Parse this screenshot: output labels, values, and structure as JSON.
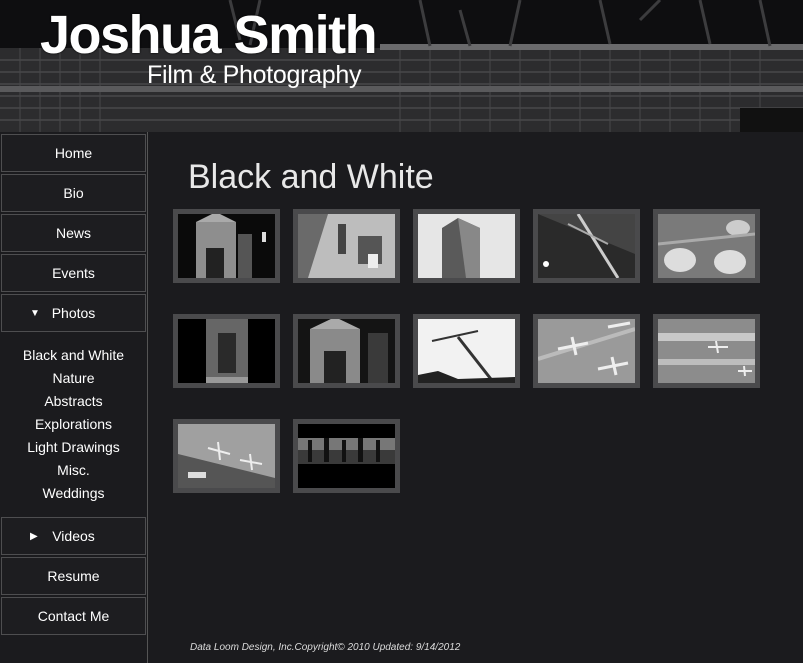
{
  "header": {
    "site_title": "Joshua Smith",
    "site_subtitle": "Film & Photography"
  },
  "sidebar": {
    "items": [
      {
        "label": "Home"
      },
      {
        "label": "Bio"
      },
      {
        "label": "News"
      },
      {
        "label": "Events"
      },
      {
        "label": "Photos",
        "icon": "triangle-down-icon"
      },
      {
        "label": "Videos",
        "icon": "triangle-right-icon"
      },
      {
        "label": "Resume"
      },
      {
        "label": "Contact Me"
      }
    ],
    "photo_subitems": [
      {
        "label": "Black and White"
      },
      {
        "label": "Nature"
      },
      {
        "label": "Abstracts"
      },
      {
        "label": "Explorations"
      },
      {
        "label": "Light Drawings"
      },
      {
        "label": "Misc."
      },
      {
        "label": "Weddings"
      }
    ]
  },
  "main": {
    "page_title": "Black and White",
    "thumbnails": [
      {
        "subject": "cathedral"
      },
      {
        "subject": "aerial-construction"
      },
      {
        "subject": "skyscraper"
      },
      {
        "subject": "tower-crane"
      },
      {
        "subject": "storage-tanks"
      },
      {
        "subject": "church-door"
      },
      {
        "subject": "cathedral"
      },
      {
        "subject": "crane"
      },
      {
        "subject": "airport-planes"
      },
      {
        "subject": "airport-runway"
      },
      {
        "subject": "airport-terminal"
      },
      {
        "subject": "silhouettes"
      }
    ]
  },
  "footer": {
    "text": "Data Loom Design, Inc.Copyright© 2010 Updated: 9/14/2012"
  },
  "colors": {
    "background": "#1b1b1e",
    "border": "#4e4e50",
    "thumb_frame": "#4a4a4c",
    "text": "#ffffff"
  }
}
